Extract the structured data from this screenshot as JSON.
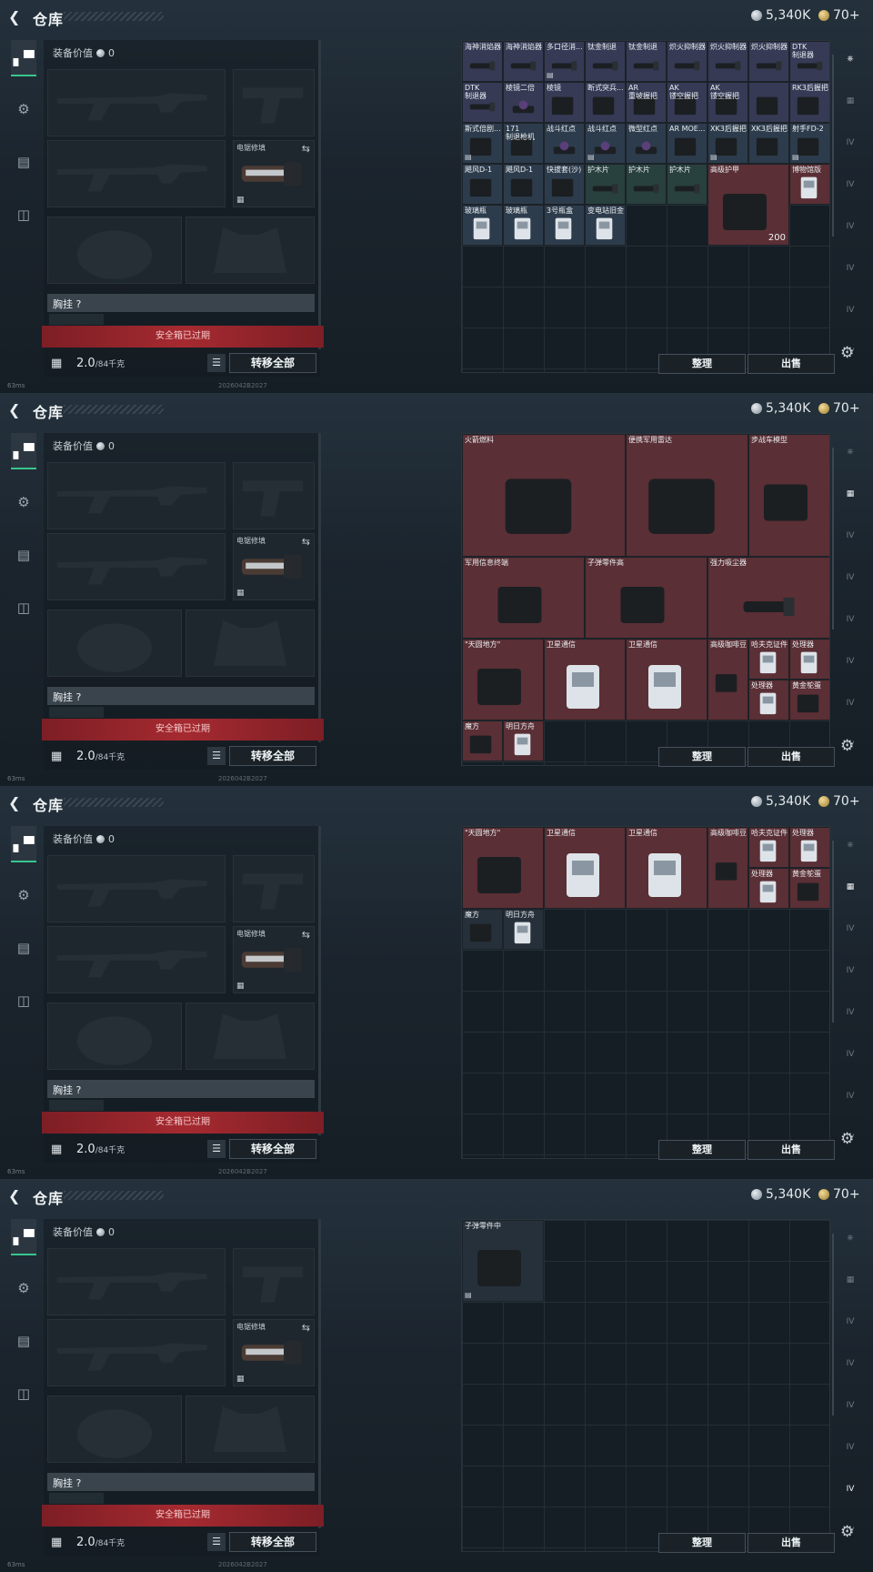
{
  "screens": [
    {
      "title": "仓库",
      "silver": "5,340K",
      "gold": "70+",
      "equip_label": "装备价值",
      "equip_value": "0",
      "slot_label": "电锯修填",
      "chest": "胸挂 ?",
      "safe": "安全箱已过期",
      "weight": "2.0",
      "weight_cap": "/84千克",
      "transfer": "转移全部",
      "sort": "整理",
      "sell": "出售",
      "ping": "63ms",
      "stamp": "2026042B2027"
    },
    {
      "title": "仓库",
      "silver": "5,340K",
      "gold": "70+",
      "equip_label": "装备价值",
      "equip_value": "0",
      "slot_label": "电锯修填",
      "chest": "胸挂 ?",
      "safe": "安全箱已过期",
      "weight": "2.0",
      "weight_cap": "/84千克",
      "transfer": "转移全部",
      "sort": "整理",
      "sell": "出售",
      "ping": "63ms",
      "stamp": "2026042B2027"
    },
    {
      "title": "仓库",
      "silver": "5,340K",
      "gold": "70+",
      "equip_label": "装备价值",
      "equip_value": "0",
      "slot_label": "电锯修填",
      "chest": "胸挂 ?",
      "safe": "安全箱已过期",
      "weight": "2.0",
      "weight_cap": "/84千克",
      "transfer": "转移全部",
      "sort": "整理",
      "sell": "出售",
      "ping": "63ms",
      "stamp": "2026042B2027"
    },
    {
      "title": "仓库",
      "silver": "5,340K",
      "gold": "70+",
      "equip_label": "装备价值",
      "equip_value": "0",
      "slot_label": "电锯修填",
      "chest": "胸挂 ?",
      "safe": "安全箱已过期",
      "weight": "2.0",
      "weight_cap": "/84千克",
      "transfer": "转移全部",
      "sort": "整理",
      "sell": "出售",
      "ping": "63ms",
      "stamp": "2026042B2027"
    }
  ],
  "items1": [
    "海神消焰器",
    "海神消焰器",
    "多口径消...",
    "钛金制退",
    "钛金制退",
    "炽火抑制器",
    "炽火抑制器",
    "炽火抑制器",
    "DTK\n制退器",
    "DTK\n制退器",
    "棱镜二倍",
    "棱镜",
    "断式突兵...",
    "AR\n重坡握把",
    "AK\n镂空握把",
    "AK\n镂空握把",
    "",
    "RK3后握把",
    "斯式倍剧...",
    "171\n制退枪机",
    "战斗红点",
    "战斗红点",
    "微型红点",
    "AR MOE...",
    "XK3后握把",
    "XK3后握把",
    "射手FD-2",
    "飓风D-1",
    "飓风D-1",
    "快拔套(沙)",
    "护木片",
    "护木片",
    "护木片",
    "高级护甲",
    "博物馆版",
    "玻璃瓶",
    "玻璃瓶",
    "3号瓶盒",
    "变电站旧金"
  ],
  "armor_qty": "200",
  "items2": [
    "火箭燃料",
    "便携军用雷达",
    "步战车模型",
    "军用信息终端",
    "子弹零件高",
    "强力吸尘器",
    "\"天圆地方\"",
    "卫星通信",
    "卫星通信",
    "高级咖啡豆",
    "哈夫克证件",
    "处理器",
    "处理器",
    "黄金鸵蛋",
    "魔方",
    "明日方舟"
  ],
  "items3": [
    "\"天圆地方\"",
    "卫星通信",
    "卫星通信",
    "高级咖啡豆",
    "哈夫克证件",
    "处理器",
    "处理器",
    "黄金鸵蛋",
    "魔方",
    "明日方舟"
  ],
  "items4": [
    "子弹零件中"
  ]
}
